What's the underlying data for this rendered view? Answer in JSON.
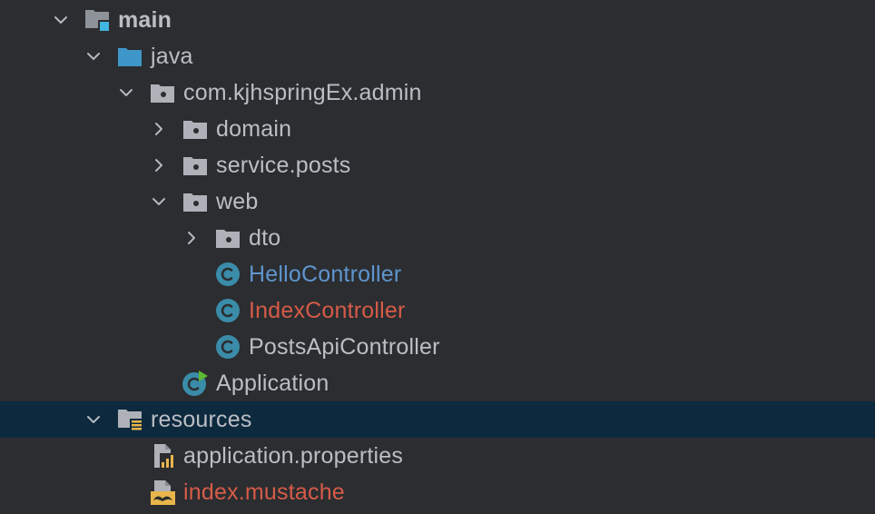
{
  "tree": {
    "main": {
      "label": "main",
      "expanded": true,
      "icon": "source-root-folder-icon"
    },
    "java": {
      "label": "java",
      "expanded": true,
      "icon": "source-folder-icon"
    },
    "package_admin": {
      "label": "com.kjhspringEx.admin",
      "expanded": true,
      "icon": "package-icon"
    },
    "domain": {
      "label": "domain",
      "expanded": false,
      "icon": "package-icon"
    },
    "service_posts": {
      "label": "service.posts",
      "expanded": false,
      "icon": "package-icon"
    },
    "web": {
      "label": "web",
      "expanded": true,
      "icon": "package-icon"
    },
    "dto": {
      "label": "dto",
      "expanded": false,
      "icon": "package-icon"
    },
    "hello_controller": {
      "label": "HelloController",
      "icon": "class-icon",
      "status_color": "#5f95ce"
    },
    "index_controller": {
      "label": "IndexController",
      "icon": "class-icon",
      "status_color": "#d65b48"
    },
    "posts_api_controller": {
      "label": "PostsApiController",
      "icon": "class-icon",
      "status_color": "#bcbec4"
    },
    "application": {
      "label": "Application",
      "icon": "spring-boot-class-icon",
      "status_color": "#bcbec4"
    },
    "resources": {
      "label": "resources",
      "expanded": true,
      "icon": "resources-folder-icon",
      "selected": true
    },
    "application_properties": {
      "label": "application.properties",
      "icon": "properties-file-icon",
      "status_color": "#bcbec4"
    },
    "index_mustache": {
      "label": "index.mustache",
      "icon": "mustache-file-icon",
      "status_color": "#d65b48"
    }
  },
  "colors": {
    "background": "#2b2d30",
    "selection": "#0d293e",
    "default_text": "#bcbec4",
    "modified": "#5f95ce",
    "unversioned": "#d65b48",
    "folder_icon": "#aeb2b8",
    "source_folder_icon": "#3e96c9",
    "class_icon": "#3a8ca9"
  }
}
